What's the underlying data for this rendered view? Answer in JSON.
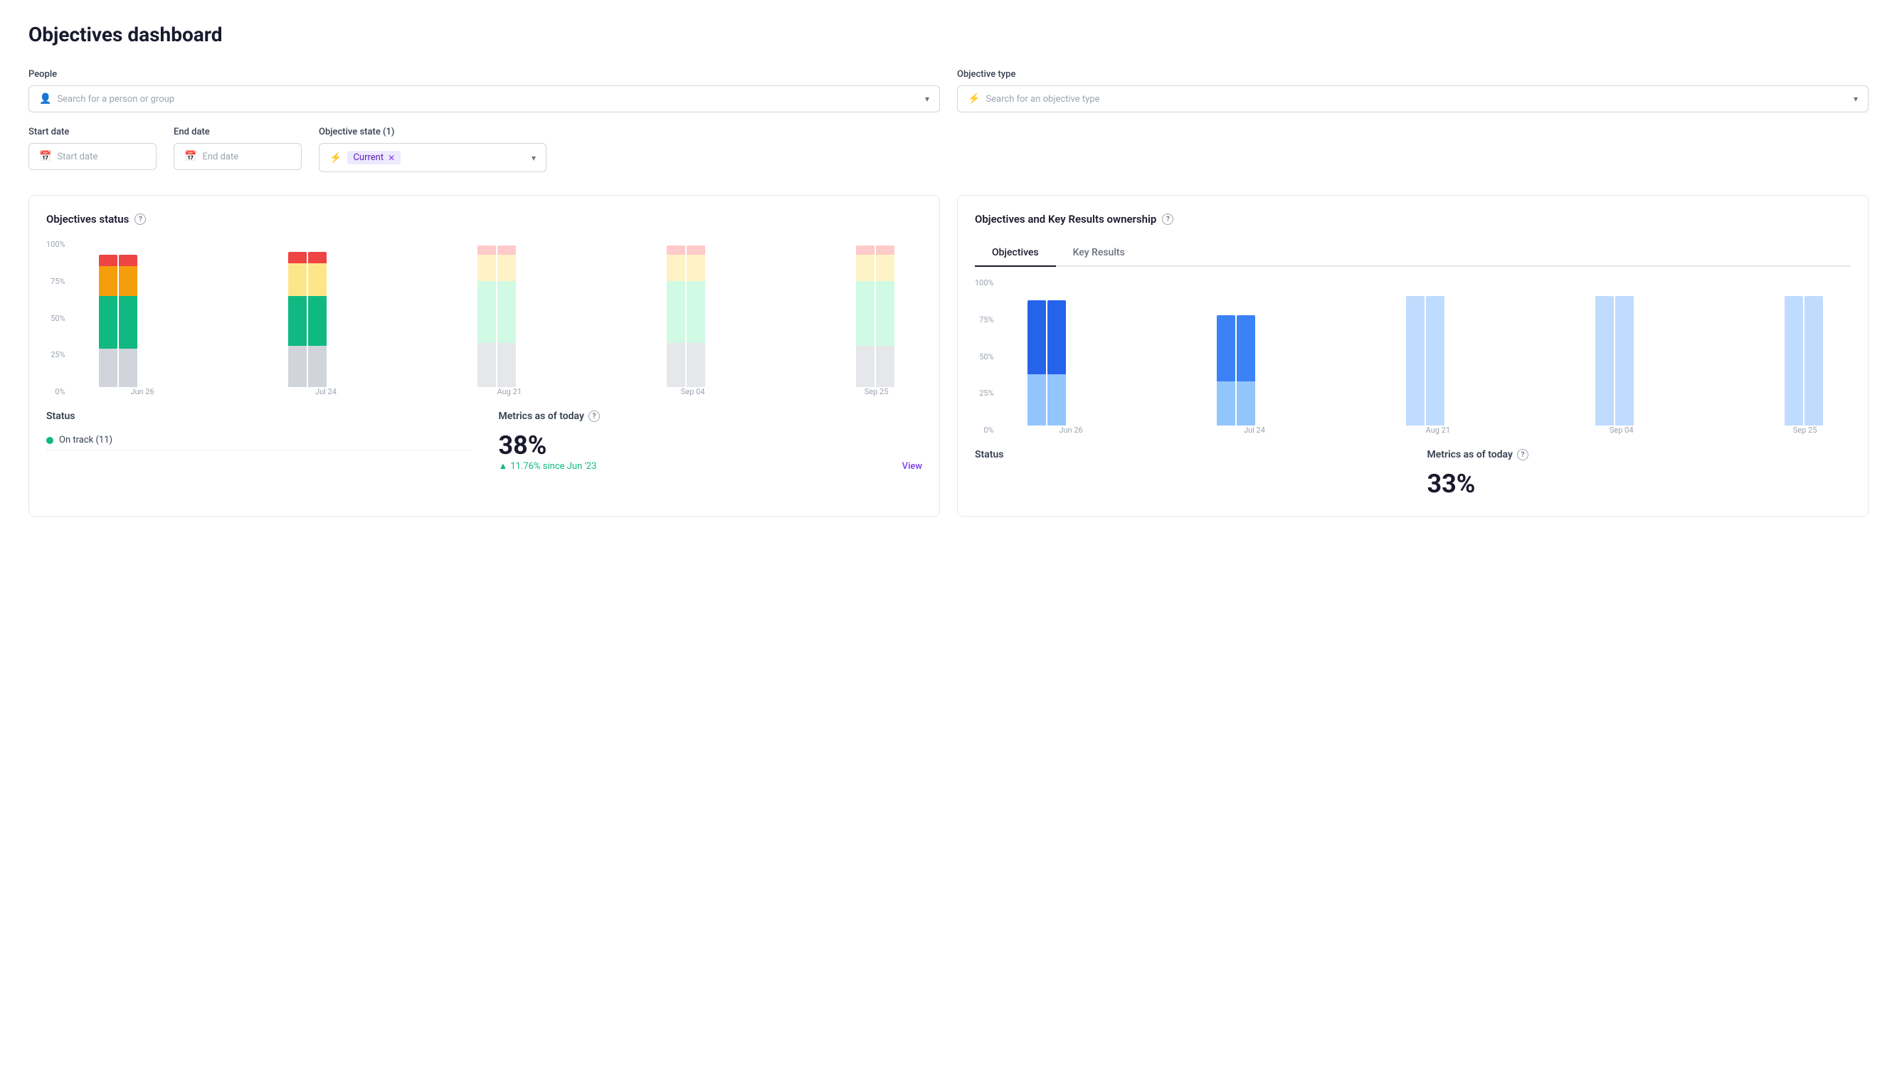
{
  "page": {
    "title": "Objectives dashboard"
  },
  "filters": {
    "people_label": "People",
    "people_placeholder": "Search for a person or group",
    "objective_type_label": "Objective type",
    "objective_type_placeholder": "Search for an objective type",
    "start_date_label": "Start date",
    "start_date_placeholder": "Start date",
    "end_date_label": "End date",
    "end_date_placeholder": "End date",
    "objective_state_label": "Objective state (1)",
    "objective_state_tag": "Current"
  },
  "objectives_status": {
    "title": "Objectives status",
    "y_labels": [
      "100%",
      "75%",
      "50%",
      "25%",
      "0%"
    ],
    "x_labels": [
      "Jun 26",
      "",
      "Jul 24",
      "",
      "Aug 21",
      "",
      "Sep 04",
      "",
      "Sep 25"
    ],
    "status_label": "Status",
    "metrics_label": "Metrics as of today",
    "metric_value": "38%",
    "metric_change": "11.76% since Jun '23",
    "view_label": "View",
    "status_items": [
      {
        "label": "On track (11)",
        "color": "#10b981"
      }
    ]
  },
  "ownership": {
    "title": "Objectives and Key Results ownership",
    "tabs": [
      "Objectives",
      "Key Results"
    ],
    "active_tab": "Objectives",
    "y_labels": [
      "100%",
      "75%",
      "50%",
      "25%",
      "0%"
    ],
    "x_labels": [
      "Jun 26",
      "",
      "Jul 24",
      "",
      "Aug 21",
      "",
      "Sep 04",
      "",
      "Sep 25"
    ],
    "status_label": "Status",
    "metrics_label": "Metrics as of today",
    "metric_value": "33%"
  },
  "colors": {
    "on_track": "#10b981",
    "at_risk": "#f59e0b",
    "behind": "#ef4444",
    "not_started": "#d1d5db",
    "paused": "#fde68a",
    "blue_dark": "#2563eb",
    "blue_light": "#bfdbfe",
    "accent": "#7c3aed"
  }
}
